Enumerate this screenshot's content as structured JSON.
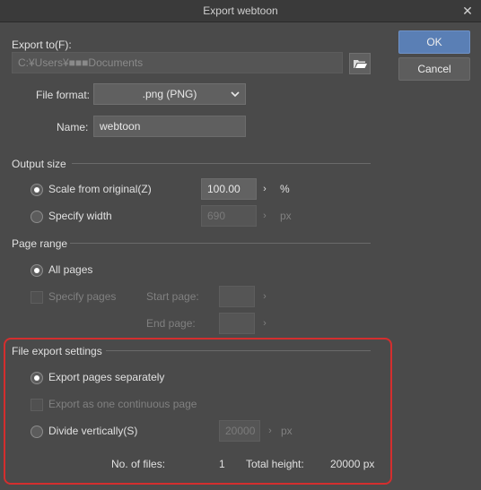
{
  "window": {
    "title": "Export webtoon",
    "close_glyph": "✕"
  },
  "buttons": {
    "ok": "OK",
    "cancel": "Cancel"
  },
  "export_to": {
    "label": "Export to(F):",
    "path": "C:¥Users¥■■■Documents",
    "browse_icon": "folder-open-icon"
  },
  "file_format": {
    "label": "File format:",
    "value": ".png (PNG)"
  },
  "name": {
    "label": "Name:",
    "value": "webtoon"
  },
  "output_size": {
    "heading": "Output size",
    "scale": {
      "label": "Scale from original(Z)",
      "value": "100.00",
      "unit": "%",
      "checked": true
    },
    "width": {
      "label": "Specify width",
      "value": "690",
      "unit": "px",
      "checked": false
    }
  },
  "page_range": {
    "heading": "Page range",
    "all_pages": {
      "label": "All pages",
      "checked": true
    },
    "specify_pages": {
      "label": "Specify pages",
      "checked": false
    },
    "start_page_label": "Start page:",
    "end_page_label": "End page:"
  },
  "file_export": {
    "heading": "File export settings",
    "separately": {
      "label": "Export pages separately",
      "checked": true
    },
    "continuous": {
      "label": "Export as one continuous page",
      "checked": false
    },
    "divide": {
      "label": "Divide vertically(S)",
      "value": "20000",
      "unit": "px",
      "checked": false
    },
    "files_label": "No. of files:",
    "files_value": "1",
    "height_label": "Total height:",
    "height_value": "20000 px"
  },
  "colors": {
    "highlight": "#d42e2e",
    "ok_button": "#5a7fb5"
  }
}
